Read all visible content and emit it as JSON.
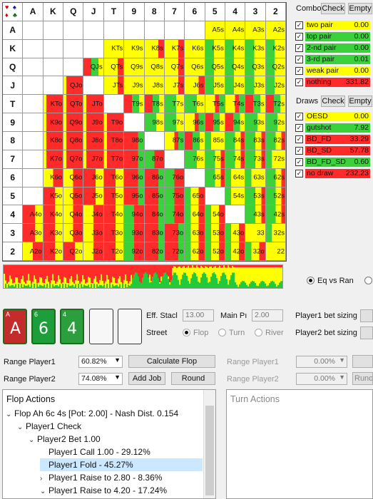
{
  "grid": {
    "ranks": [
      "A",
      "K",
      "Q",
      "J",
      "T",
      "9",
      "8",
      "7",
      "6",
      "5",
      "4",
      "3",
      "2"
    ],
    "cells": [
      [
        "",
        "",
        "",
        "",
        "",
        "",
        "",
        "",
        "",
        "A5s",
        "A4s",
        "A3s",
        "A2s"
      ],
      [
        "",
        "",
        "",
        "",
        "KTs",
        "K9s",
        "K8s",
        "K7s",
        "K6s",
        "K5s",
        "K4s",
        "K3s",
        "K2s"
      ],
      [
        "",
        "",
        "",
        "QJs",
        "QTs",
        "Q9s",
        "Q8s",
        "Q7s",
        "Q6s",
        "Q5s",
        "Q4s",
        "Q3s",
        "Q2s"
      ],
      [
        "",
        "",
        "QJo",
        "",
        "JTs",
        "J9s",
        "J8s",
        "J7s",
        "J6s",
        "J5s",
        "J4s",
        "J3s",
        "J2s"
      ],
      [
        "",
        "KTo",
        "QTo",
        "JTo",
        "",
        "T9s",
        "T8s",
        "T7s",
        "T6s",
        "T5s",
        "T4s",
        "T3s",
        "T2s"
      ],
      [
        "",
        "K9o",
        "Q9o",
        "J9o",
        "T9o",
        "",
        "98s",
        "97s",
        "96s",
        "95s",
        "94s",
        "93s",
        "92s"
      ],
      [
        "",
        "K8o",
        "Q8o",
        "J8o",
        "T8o",
        "98o",
        "",
        "87s",
        "86s",
        "85s",
        "84s",
        "83s",
        "82s"
      ],
      [
        "",
        "K7o",
        "Q7o",
        "J7o",
        "T7o",
        "97o",
        "87o",
        "",
        "76s",
        "75s",
        "74s",
        "73s",
        "72s"
      ],
      [
        "",
        "K6o",
        "Q6o",
        "J6o",
        "T6o",
        "96o",
        "86o",
        "76o",
        "",
        "65s",
        "64s",
        "63s",
        "62s"
      ],
      [
        "",
        "K5o",
        "Q5o",
        "J5o",
        "T5o",
        "95o",
        "85o",
        "75o",
        "65o",
        "",
        "54s",
        "53s",
        "52s"
      ],
      [
        "A4o",
        "K4o",
        "Q4o",
        "J4o",
        "T4o",
        "94o",
        "84o",
        "74o",
        "64o",
        "54o",
        "",
        "43s",
        "42s"
      ],
      [
        "A3o",
        "K3o",
        "Q3o",
        "J3o",
        "T3o",
        "93o",
        "83o",
        "73o",
        "63o",
        "53o",
        "43o",
        "33",
        "32s"
      ],
      [
        "A2o",
        "K2o",
        "Q2o",
        "J2o",
        "T2o",
        "92o",
        "82o",
        "72o",
        "62o",
        "52o",
        "42o",
        "32o",
        "22"
      ]
    ]
  },
  "combo": {
    "title": "Combo",
    "check_label": "Check",
    "empty_label": "Empty",
    "rows": [
      {
        "name": "two pair",
        "value": "0.00",
        "color": "#ffff00"
      },
      {
        "name": "top pair",
        "value": "0.00",
        "color": "#3bd13b"
      },
      {
        "name": "2-nd pair",
        "value": "0.00",
        "color": "#3bd13b"
      },
      {
        "name": "3-rd pair",
        "value": "0.01",
        "color": "#3bd13b"
      },
      {
        "name": "weak pair",
        "value": "0.00",
        "color": "#ffff00"
      },
      {
        "name": "nothing",
        "value": "331.82",
        "color": "#ff2a2a"
      }
    ]
  },
  "draws": {
    "title": "Draws",
    "check_label": "Check",
    "empty_label": "Empty",
    "rows": [
      {
        "name": "OESD",
        "value": "0.00",
        "color": "#ffff00"
      },
      {
        "name": "gutshot",
        "value": "7.92",
        "color": "#3bd13b"
      },
      {
        "name": "BD_FD",
        "value": "33.29",
        "color": "#ff2a2a"
      },
      {
        "name": "BD_SD",
        "value": "57.78",
        "color": "#ff2a2a"
      },
      {
        "name": "BD_FD_SD",
        "value": "0.60",
        "color": "#3bd13b"
      },
      {
        "name": "no draw",
        "value": "232.23",
        "color": "#ff2a2a"
      }
    ]
  },
  "eq_vs_ran": "Eq vs Ran",
  "board": {
    "cards": [
      {
        "rank": "A",
        "suit": "♥",
        "label": "A"
      },
      {
        "rank": "6",
        "suit": "♣",
        "label": "6"
      },
      {
        "rank": "4",
        "suit": "♠",
        "label": "4"
      }
    ]
  },
  "settings": {
    "eff_stack_label": "Eff. Stacl",
    "eff_stack_value": "13.00",
    "main_pot_label": "Main Pı",
    "main_pot_value": "2.00",
    "street_label": "Street",
    "streets": [
      "Flop",
      "Turn",
      "River"
    ],
    "p1_bet_sizing": "Player1 bet sizing",
    "p2_bet_sizing": "Player2 bet sizing"
  },
  "ranges": {
    "p1_label": "Range Player1",
    "p1_value": "60.82%",
    "p2_label": "Range Player2",
    "p2_value": "74.08%",
    "calc_flop": "Calculate Flop",
    "add_job": "Add Job",
    "round": "Round",
    "p1_label_b": "Range Player1",
    "p1_value_b": "0.00%",
    "p2_label_b": "Range Player2",
    "p2_value_b": "0.00%",
    "runout": "Runou"
  },
  "flop_actions": {
    "title": "Flop Actions",
    "nodes": [
      {
        "text": "Flop Ah 6c 4s [Pot: 2.00] - Nash Dist. 0.154",
        "chev": "⌄",
        "indent": 0
      },
      {
        "text": "Player1 Check",
        "chev": "⌄",
        "indent": 1
      },
      {
        "text": "Player2 Bet 1.00",
        "chev": "⌄",
        "indent": 2
      },
      {
        "text": "Player1 Call 1.00 - 29.12%",
        "chev": "",
        "indent": 3
      },
      {
        "text": "Player1 Fold - 45.27%",
        "chev": "",
        "indent": 3,
        "selected": true
      },
      {
        "text": "Player1 Raise to 2.80 - 8.36%",
        "chev": "›",
        "indent": 3
      },
      {
        "text": "Player1 Raise to 4.20 - 17.24%",
        "chev": "⌄",
        "indent": 3
      }
    ]
  },
  "turn_actions": {
    "title": "Turn Actions"
  }
}
